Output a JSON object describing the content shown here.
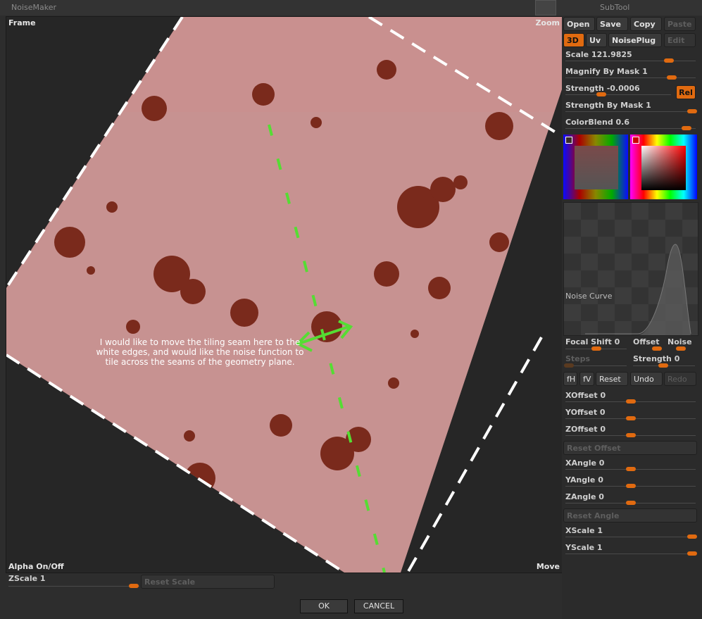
{
  "window": {
    "title": "NoiseMaker",
    "subtool_label": "SubTool"
  },
  "viewport": {
    "frame_label": "Frame",
    "zoom_label": "Zoom",
    "alpha_label": "Alpha On/Off",
    "move_label": "Move",
    "annotation": "I would like to move the tiling seam here to the white edges, and would like the noise function to tile across the seams of the geometry plane."
  },
  "bottom": {
    "zscale_label": "ZScale 1",
    "reset_scale_label": "Reset Scale",
    "ok_label": "OK",
    "cancel_label": "CANCEL"
  },
  "panel": {
    "open": "Open",
    "save": "Save",
    "copy": "Copy",
    "paste": "Paste",
    "mode_3d": "3D",
    "uv": "Uv",
    "noiseplug": "NoisePlug",
    "edit": "Edit",
    "scale": "Scale 121.9825",
    "magnify": "Magnify By Mask 1",
    "strength": "Strength -0.0006",
    "rel": "Rel",
    "strength_mask": "Strength By Mask 1",
    "colorblend": "ColorBlend 0.6",
    "noise_curve": "Noise Curve",
    "focal_shift": "Focal Shift 0",
    "offset": "Offset",
    "noise": "Noise",
    "steps": "Steps",
    "strength2": "Strength 0",
    "fh": "fH",
    "fv": "fV",
    "reset": "Reset",
    "undo": "Undo",
    "redo": "Redo",
    "xoffset": "XOffset 0",
    "yoffset": "YOffset 0",
    "zoffset": "ZOffset 0",
    "reset_offset": "Reset Offset",
    "xangle": "XAngle 0",
    "yangle": "YAngle 0",
    "zangle": "ZAngle 0",
    "reset_angle": "Reset Angle",
    "xscale": "XScale 1",
    "yscale": "YScale 1"
  },
  "colors": {
    "accent": "#e06a10",
    "plane": "#c9908f",
    "seam_green": "#55dd33"
  }
}
